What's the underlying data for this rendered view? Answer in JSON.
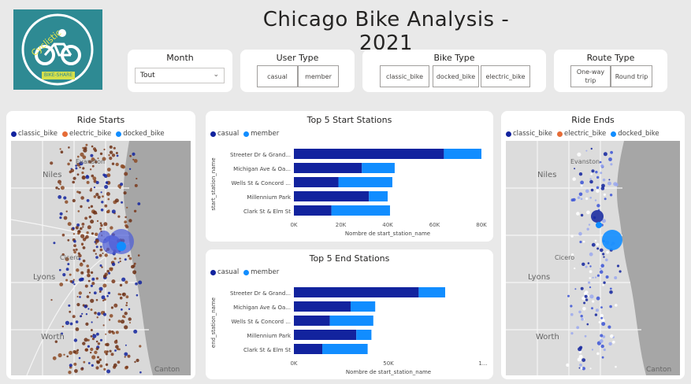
{
  "header": {
    "title": "Chicago Bike Analysis - 2021",
    "logo_text_top": "Cyclistic",
    "logo_text_bottom": "BIKE-SHARE"
  },
  "slicers": {
    "month": {
      "title": "Month",
      "value": "Tout"
    },
    "user_type": {
      "title": "User Type",
      "options": [
        "casual",
        "member"
      ]
    },
    "bike_type": {
      "title": "Bike Type",
      "options": [
        "classic_bike",
        "docked_bike",
        "electric_bike"
      ]
    },
    "route_type": {
      "title": "Route Type",
      "options": [
        "One-way trip",
        "Round trip"
      ]
    }
  },
  "ride_starts": {
    "title": "Ride Starts",
    "legend": [
      "classic_bike",
      "electric_bike",
      "docked_bike"
    ],
    "map_labels": [
      "Evanston",
      "Niles",
      "Cicero",
      "Lyons",
      "Worth",
      "Canton"
    ]
  },
  "ride_ends": {
    "title": "Ride Ends",
    "legend": [
      "classic_bike",
      "electric_bike",
      "docked_bike"
    ],
    "map_labels": [
      "Evanston",
      "Niles",
      "Cicero",
      "Lyons",
      "Worth",
      "Canton"
    ]
  },
  "colors": {
    "casual": "#12239e",
    "member": "#118dff",
    "classic_bike": "#12239e",
    "electric_bike": "#e66c37",
    "docked_bike": "#118dff",
    "logo_bg": "#2e8a93"
  },
  "top_start": {
    "title": "Top 5 Start Stations",
    "legend": [
      "casual",
      "member"
    ],
    "ylabel": "start_station_name",
    "xlabel": "Nombre de start_station_name",
    "ticks": [
      "0K",
      "20K",
      "40K",
      "60K",
      "80K"
    ]
  },
  "top_end": {
    "title": "Top 5 End Stations",
    "legend": [
      "casual",
      "member"
    ],
    "ylabel": "end_station_name",
    "xlabel": "Nombre de start_station_name",
    "ticks": [
      "0K",
      "50K",
      "1..."
    ]
  },
  "chart_data": [
    {
      "type": "bar",
      "orientation": "horizontal",
      "stacked": true,
      "title": "Top 5 Start Stations",
      "categories": [
        "Streeter Dr & Grand...",
        "Michigan Ave & Oa...",
        "Wells St & Concord ...",
        "Millennium Park",
        "Clark St & Elm St"
      ],
      "series": [
        {
          "name": "casual",
          "values": [
            64000,
            29000,
            19000,
            32000,
            16000
          ]
        },
        {
          "name": "member",
          "values": [
            16000,
            14000,
            23000,
            8000,
            25000
          ]
        }
      ],
      "xlabel": "Nombre de start_station_name",
      "ylabel": "start_station_name",
      "xlim": [
        0,
        80000
      ]
    },
    {
      "type": "bar",
      "orientation": "horizontal",
      "stacked": true,
      "title": "Top 5 End Stations",
      "categories": [
        "Streeter Dr & Grand...",
        "Michigan Ave & Oa...",
        "Wells St & Concord ...",
        "Millennium Park",
        "Clark St & Elm St"
      ],
      "series": [
        {
          "name": "casual",
          "values": [
            66000,
            30000,
            19000,
            33000,
            15000
          ]
        },
        {
          "name": "member",
          "values": [
            14000,
            13000,
            23000,
            8000,
            24000
          ]
        }
      ],
      "xlabel": "Nombre de start_station_name",
      "ylabel": "end_station_name",
      "xlim": [
        0,
        100000
      ]
    }
  ]
}
